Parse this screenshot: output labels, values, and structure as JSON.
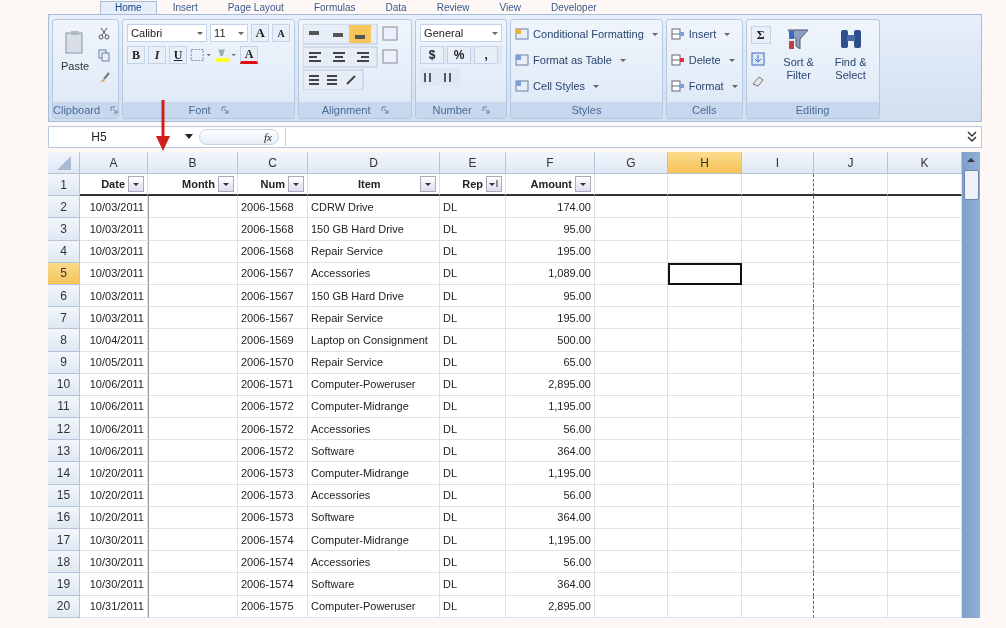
{
  "tabs": [
    {
      "label": "Home",
      "selected": true
    },
    {
      "label": "Insert",
      "selected": false
    },
    {
      "label": "Page Layout",
      "selected": false
    },
    {
      "label": "Formulas",
      "selected": false
    },
    {
      "label": "Data",
      "selected": false
    },
    {
      "label": "Review",
      "selected": false
    },
    {
      "label": "View",
      "selected": false
    },
    {
      "label": "Developer",
      "selected": false
    }
  ],
  "ribbon": {
    "groups": [
      {
        "kind": "clipboard",
        "label": "Clipboard",
        "paste": "Paste"
      },
      {
        "kind": "font",
        "label": "Font",
        "font_name": "Calibri",
        "font_size": "11",
        "size_buttons": [
          "A",
          "A"
        ],
        "style_buttons": [
          "B",
          "I",
          "U"
        ],
        "font_color": "A"
      },
      {
        "kind": "alignment",
        "label": "Alignment"
      },
      {
        "kind": "number",
        "label": "Number",
        "format": "General",
        "symbols": [
          "$",
          "%",
          ","
        ]
      },
      {
        "kind": "styles",
        "label": "Styles",
        "buttons": [
          "Conditional Formatting",
          "Format as Table",
          "Cell Styles"
        ]
      },
      {
        "kind": "cells",
        "label": "Cells",
        "buttons": [
          "Insert",
          "Delete",
          "Format"
        ]
      },
      {
        "kind": "editing",
        "label": "Editing",
        "autosum": "Σ",
        "buttons": [
          "Sort & Filter",
          "Find & Select"
        ]
      }
    ]
  },
  "formula_bar": {
    "name_box": "H5",
    "fx": "fx"
  },
  "table": {
    "columns": [
      {
        "letter": "A",
        "selected": false
      },
      {
        "letter": "B",
        "selected": false
      },
      {
        "letter": "C",
        "selected": false
      },
      {
        "letter": "D",
        "selected": false
      },
      {
        "letter": "E",
        "selected": false
      },
      {
        "letter": "F",
        "selected": false
      },
      {
        "letter": "G",
        "selected": false
      },
      {
        "letter": "H",
        "selected": true
      },
      {
        "letter": "I",
        "selected": false
      },
      {
        "letter": "J",
        "selected": false
      },
      {
        "letter": "K",
        "selected": false
      }
    ],
    "header_row": {
      "number": "1",
      "selected": false,
      "cells": [
        {
          "label": "Date",
          "kind": "filter"
        },
        {
          "label": "Month",
          "kind": "filter"
        },
        {
          "label": "Num",
          "kind": "filter"
        },
        {
          "label": "Item",
          "kind": "filter"
        },
        {
          "label": "Rep",
          "kind": "sorted"
        },
        {
          "label": "Amount",
          "kind": "filter"
        }
      ]
    },
    "rows": [
      {
        "number": "2",
        "selected": false,
        "date": "10/03/2011",
        "num": "2006-1568",
        "item": "CDRW Drive",
        "rep": "DL",
        "amount": "174.00"
      },
      {
        "number": "3",
        "selected": false,
        "date": "10/03/2011",
        "num": "2006-1568",
        "item": "150 GB Hard Drive",
        "rep": "DL",
        "amount": "95.00"
      },
      {
        "number": "4",
        "selected": false,
        "date": "10/03/2011",
        "num": "2006-1568",
        "item": "Repair Service",
        "rep": "DL",
        "amount": "195.00"
      },
      {
        "number": "5",
        "selected": true,
        "date": "10/03/2011",
        "num": "2006-1567",
        "item": "Accessories",
        "rep": "DL",
        "amount": "1,089.00"
      },
      {
        "number": "6",
        "selected": false,
        "date": "10/03/2011",
        "num": "2006-1567",
        "item": "150 GB Hard Drive",
        "rep": "DL",
        "amount": "95.00"
      },
      {
        "number": "7",
        "selected": false,
        "date": "10/03/2011",
        "num": "2006-1567",
        "item": "Repair Service",
        "rep": "DL",
        "amount": "195.00"
      },
      {
        "number": "8",
        "selected": false,
        "date": "10/04/2011",
        "num": "2006-1569",
        "item": "Laptop on Consignment",
        "rep": "DL",
        "amount": "500.00"
      },
      {
        "number": "9",
        "selected": false,
        "date": "10/05/2011",
        "num": "2006-1570",
        "item": "Repair Service",
        "rep": "DL",
        "amount": "65.00"
      },
      {
        "number": "10",
        "selected": false,
        "date": "10/06/2011",
        "num": "2006-1571",
        "item": "Computer-Poweruser",
        "rep": "DL",
        "amount": "2,895.00"
      },
      {
        "number": "11",
        "selected": false,
        "date": "10/06/2011",
        "num": "2006-1572",
        "item": "Computer-Midrange",
        "rep": "DL",
        "amount": "1,195.00"
      },
      {
        "number": "12",
        "selected": false,
        "date": "10/06/2011",
        "num": "2006-1572",
        "item": "Accessories",
        "rep": "DL",
        "amount": "56.00"
      },
      {
        "number": "13",
        "selected": false,
        "date": "10/06/2011",
        "num": "2006-1572",
        "item": "Software",
        "rep": "DL",
        "amount": "364.00"
      },
      {
        "number": "14",
        "selected": false,
        "date": "10/20/2011",
        "num": "2006-1573",
        "item": "Computer-Midrange",
        "rep": "DL",
        "amount": "1,195.00"
      },
      {
        "number": "15",
        "selected": false,
        "date": "10/20/2011",
        "num": "2006-1573",
        "item": "Accessories",
        "rep": "DL",
        "amount": "56.00"
      },
      {
        "number": "16",
        "selected": false,
        "date": "10/20/2011",
        "num": "2006-1573",
        "item": "Software",
        "rep": "DL",
        "amount": "364.00"
      },
      {
        "number": "17",
        "selected": false,
        "date": "10/30/2011",
        "num": "2006-1574",
        "item": "Computer-Midrange",
        "rep": "DL",
        "amount": "1,195.00"
      },
      {
        "number": "18",
        "selected": false,
        "date": "10/30/2011",
        "num": "2006-1574",
        "item": "Accessories",
        "rep": "DL",
        "amount": "56.00"
      },
      {
        "number": "19",
        "selected": false,
        "date": "10/30/2011",
        "num": "2006-1574",
        "item": "Software",
        "rep": "DL",
        "amount": "364.00"
      },
      {
        "number": "20",
        "selected": false,
        "date": "10/31/2011",
        "num": "2006-1575",
        "item": "Computer-Poweruser",
        "rep": "DL",
        "amount": "2,895.00"
      }
    ]
  }
}
